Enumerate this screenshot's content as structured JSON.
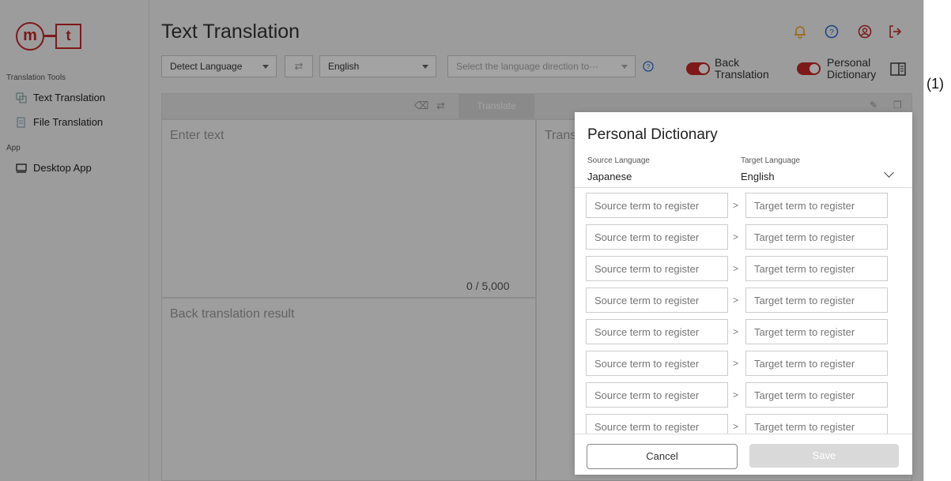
{
  "logo": {
    "left": "m",
    "right": "t"
  },
  "sidebar": {
    "section_tools": "Translation Tools",
    "items": [
      {
        "label": "Text Translation",
        "icon": "text-translation-icon"
      },
      {
        "label": "File Translation",
        "icon": "file-translation-icon"
      }
    ],
    "section_app": "App",
    "app_items": [
      {
        "label": "Desktop App",
        "icon": "desktop-icon"
      }
    ]
  },
  "header": {
    "title": "Text Translation",
    "icons": [
      "bell-icon",
      "help-icon",
      "account-icon",
      "logout-icon"
    ]
  },
  "toolbar": {
    "source_lang": "Detect Language",
    "target_lang": "English",
    "direction_placeholder": "Select the language direction to···",
    "back_translation_label_1": "Back",
    "back_translation_label_2": "Translation",
    "personal_dictionary_label_1": "Personal",
    "personal_dictionary_label_2": "Dictionary",
    "translate_label": "Translate"
  },
  "source": {
    "placeholder": "Enter text",
    "counter": "0 / 5,000"
  },
  "back": {
    "placeholder": "Back translation result"
  },
  "target": {
    "placeholder": "Trans"
  },
  "dialog": {
    "title": "Personal Dictionary",
    "source_label": "Source Language",
    "source_value": "Japanese",
    "target_label": "Target Language",
    "target_value": "English",
    "rows": [
      {
        "source": "Source term to register",
        "target": "Target term to register"
      },
      {
        "source": "Source term to register",
        "target": "Target term to register"
      },
      {
        "source": "Source term to register",
        "target": "Target term to register"
      },
      {
        "source": "Source term to register",
        "target": "Target term to register"
      },
      {
        "source": "Source term to register",
        "target": "Target term to register"
      },
      {
        "source": "Source term to register",
        "target": "Target term to register"
      },
      {
        "source": "Source term to register",
        "target": "Target term to register"
      },
      {
        "source": "Source term to register",
        "target": "Target term to register"
      }
    ],
    "arrow": ">",
    "cancel": "Cancel",
    "save": "Save"
  },
  "callout": "(1)",
  "colors": {
    "brand": "#c62828",
    "toggle_on": "#c62828",
    "accent_icon": "#f5a623",
    "help_icon": "#2d6fd1"
  }
}
